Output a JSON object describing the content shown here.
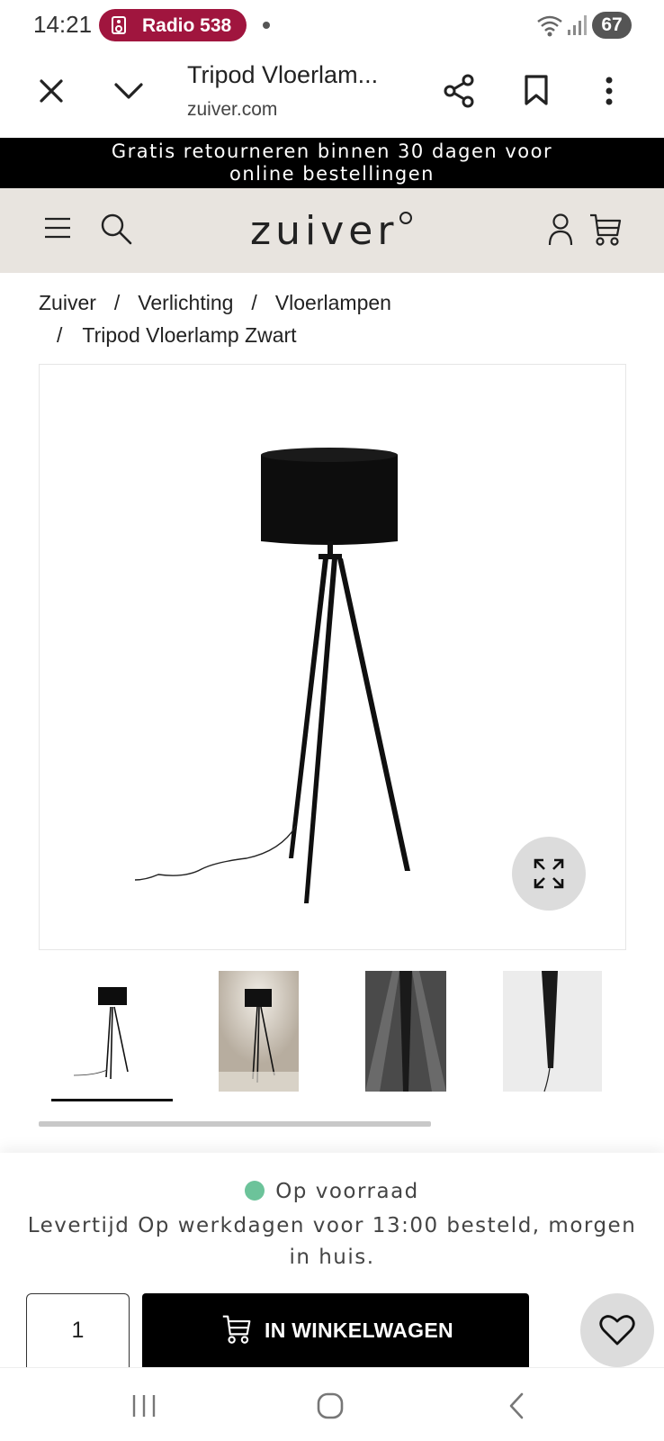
{
  "status_bar": {
    "time": "14:21",
    "notification_pill": "Radio 538",
    "battery": "67",
    "pill_color": "#a0153e",
    "icons": [
      "radio-icon",
      "wifi-icon",
      "signal-icon"
    ]
  },
  "browser": {
    "page_title": "Tripod Vloerlam...",
    "url": "zuiver.com",
    "icons": [
      "close-icon",
      "chevron-down-icon",
      "share-icon",
      "bookmark-icon",
      "more-vert-icon"
    ]
  },
  "announcement": {
    "line1": "Gratis retourneren binnen 30 dagen voor",
    "line2": "online bestellingen"
  },
  "site_header": {
    "logo": "zuiver",
    "background": "#e8e4df",
    "icons": [
      "menu-icon",
      "search-icon",
      "account-icon",
      "cart-icon"
    ]
  },
  "breadcrumb": {
    "items": [
      "Zuiver",
      "Verlichting",
      "Vloerlampen",
      "Tripod Vloerlamp Zwart"
    ],
    "separator": "/"
  },
  "product": {
    "image_alt": "Tripod Vloerlamp Zwart",
    "thumbnail_count": 4,
    "active_thumbnail": 1
  },
  "purchase": {
    "stock_status": "Op voorraad",
    "stock_color": "#6cc39a",
    "delivery_text": "Levertijd Op werkdagen voor 13:00 besteld, morgen in huis.",
    "quantity": "1",
    "add_to_cart_label": "IN WINKELWAGEN"
  }
}
